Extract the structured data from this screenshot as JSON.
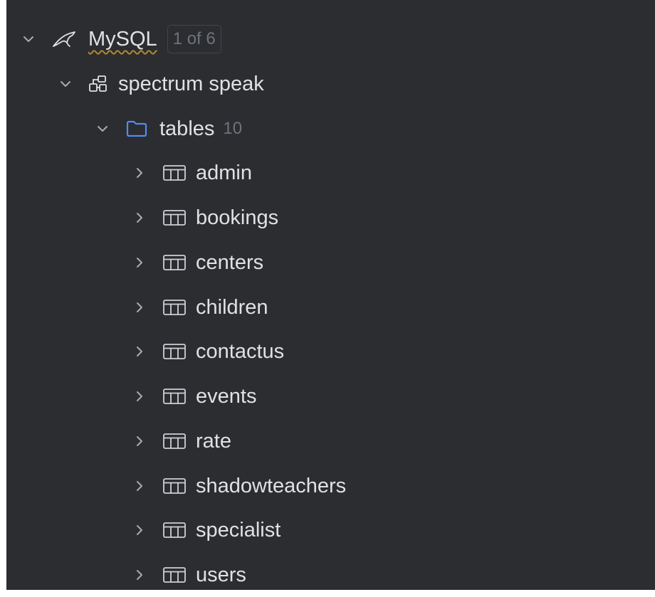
{
  "colors": {
    "panel_background": "#2b2d30",
    "text": "#dfe1e5",
    "muted_text": "#6f737a",
    "chevron": "#a8abb0",
    "folder_icon": "#548af7",
    "table_icon": "#ced0d6",
    "spellcheck_underline": "#b3862c"
  },
  "tree": {
    "datasource": {
      "label": "MySQL",
      "badge": "1 of 6",
      "icon": "mysql-dolphin-icon",
      "expanded": true
    },
    "schema": {
      "label": "spectrum speak",
      "icon": "schema-icon",
      "expanded": true
    },
    "tables_folder": {
      "label": "tables",
      "count": "10",
      "icon": "folder-icon",
      "expanded": true
    },
    "tables": [
      {
        "label": "admin",
        "icon": "table-icon"
      },
      {
        "label": "bookings",
        "icon": "table-icon"
      },
      {
        "label": "centers",
        "icon": "table-icon"
      },
      {
        "label": "children",
        "icon": "table-icon"
      },
      {
        "label": "contactus",
        "icon": "table-icon"
      },
      {
        "label": "events",
        "icon": "table-icon"
      },
      {
        "label": "rate",
        "icon": "table-icon"
      },
      {
        "label": "shadowteachers",
        "icon": "table-icon"
      },
      {
        "label": "specialist",
        "icon": "table-icon"
      },
      {
        "label": "users",
        "icon": "table-icon"
      }
    ]
  }
}
